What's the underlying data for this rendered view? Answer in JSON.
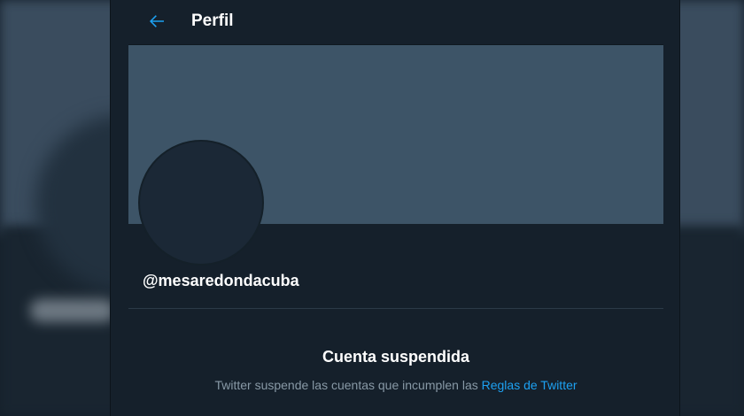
{
  "header": {
    "title": "Perfil",
    "back_icon": "arrow-left-icon"
  },
  "profile": {
    "handle": "@mesaredondacuba"
  },
  "suspension": {
    "title": "Cuenta suspendida",
    "text": "Twitter suspende las cuentas que incumplen las ",
    "link_label": "Reglas de Twitter"
  },
  "colors": {
    "accent": "#1da1f2",
    "background": "#15202b",
    "banner": "#3d5467",
    "secondary_text": "#8899a6"
  }
}
